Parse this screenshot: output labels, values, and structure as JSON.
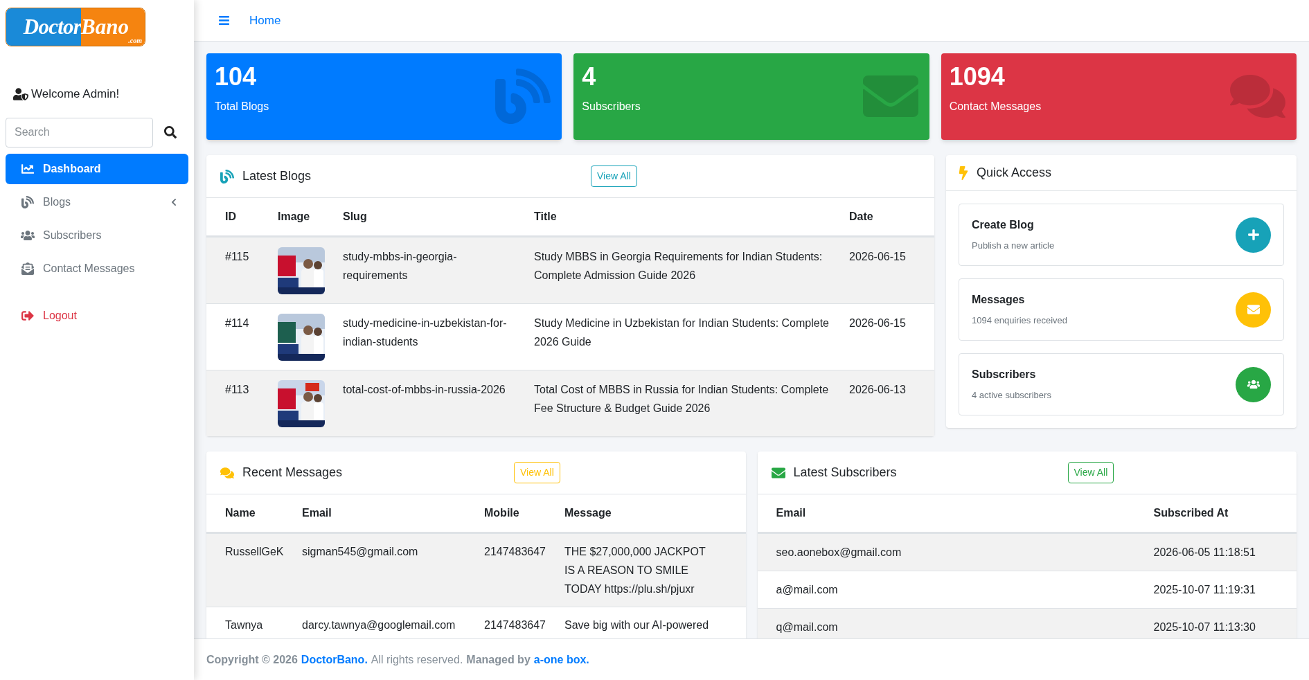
{
  "sidebar": {
    "logo": {
      "left": "Doctor",
      "right": "Bano",
      "suffix": ".com"
    },
    "welcome": "Welcome Admin!",
    "search": {
      "placeholder": "Search"
    },
    "nav": [
      {
        "label": "Dashboard",
        "kind": "link",
        "selected": true
      },
      {
        "label": "Blogs",
        "kind": "link",
        "selected": false,
        "expanded": false
      },
      {
        "label": "Subscribers",
        "kind": "link",
        "selected": false
      },
      {
        "label": "Contact Messages",
        "kind": "link",
        "selected": false
      },
      {
        "label": "Logout",
        "kind": "danger",
        "selected": false
      }
    ]
  },
  "header": {
    "breadcrumb": "Home"
  },
  "stats": [
    {
      "value": "104",
      "label": "Total Blogs",
      "color": "#007bff"
    },
    {
      "value": "4",
      "label": "Subscribers",
      "color": "#28a745"
    },
    {
      "value": "1094",
      "label": "Contact Messages",
      "color": "#dc3545"
    }
  ],
  "latest_blogs": {
    "title": "Latest Blogs",
    "button": "View All",
    "color": "#17a2b8",
    "columns": [
      "ID",
      "Image",
      "Slug",
      "Title",
      "Date"
    ],
    "rows": [
      {
        "id": "#115",
        "slug": "study-mbbs-in-georgia-requirements",
        "title": "Study MBBS in Georgia Requirements for Indian Students: Complete Admission Guide 2026",
        "date": "2026-06-15"
      },
      {
        "id": "#114",
        "slug": "study-medicine-in-uzbekistan-for-indian-students",
        "title": "Study Medicine in Uzbekistan for Indian Students: Complete 2026 Guide",
        "date": "2026-06-15"
      },
      {
        "id": "#113",
        "slug": "total-cost-of-mbbs-in-russia-2026",
        "title": "Total Cost of MBBS in Russia for Indian Students: Complete Fee Structure & Budget Guide 2026",
        "date": "2026-06-13"
      }
    ]
  },
  "quick_access": {
    "title": "Quick Access",
    "items": [
      {
        "title": "Create Blog",
        "subtitle": "Publish a new article",
        "color": "#17a2b8"
      },
      {
        "title": "Messages",
        "subtitle": "1094 enquiries received",
        "color": "#ffc107"
      },
      {
        "title": "Subscribers",
        "subtitle": "4 active subscribers",
        "color": "#28a745"
      }
    ]
  },
  "recent_messages": {
    "title": "Recent Messages",
    "button": "View All",
    "color": "#ffc107",
    "columns": [
      "Name",
      "Email",
      "Mobile",
      "Message"
    ],
    "rows": [
      {
        "name": "RussellGeK",
        "email": "sigman545@gmail.com",
        "mobile": "2147483647",
        "message": "THE $27,000,000 JACKPOT IS A REASON TO SMILE TODAY https://plu.sh/pjuxr"
      },
      {
        "name": "Tawnya",
        "email": "darcy.tawnya@googlemail.com",
        "mobile": "2147483647",
        "message": "Save big with our AI-powered"
      }
    ]
  },
  "latest_subscribers": {
    "title": "Latest Subscribers",
    "button": "View All",
    "color": "#28a745",
    "columns": [
      "Email",
      "Subscribed At"
    ],
    "rows": [
      {
        "email": "seo.aonebox@gmail.com",
        "subscribed_at": "2026-06-05 11:18:51"
      },
      {
        "email": "a@mail.com",
        "subscribed_at": "2025-10-07 11:19:31"
      },
      {
        "email": "q@mail.com",
        "subscribed_at": "2025-10-07 11:13:30"
      }
    ]
  },
  "footer": [
    {
      "text": "Copyright © 2026",
      "kind": "bold"
    },
    {
      "text": "DoctorBano.",
      "kind": "link"
    },
    {
      "text": "All rights reserved.",
      "kind": "plain"
    },
    {
      "text": "Managed by",
      "kind": "bold"
    },
    {
      "text": "a-one box.",
      "kind": "link"
    }
  ]
}
